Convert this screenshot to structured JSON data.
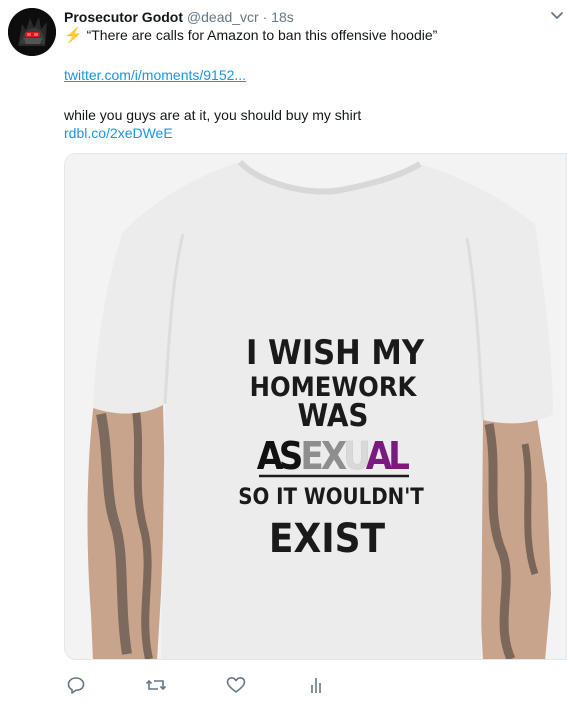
{
  "tweet": {
    "author_name": "Prosecutor Godot",
    "handle": "@dead_vcr",
    "separator": "·",
    "time": "18s",
    "quote_text": "“There are calls for Amazon to ban this offensive hoodie”",
    "link": "twitter.com/i/moments/9152...",
    "body": "while you guys are at it, you should buy my shirt",
    "short_link": "rdbl.co/2xeDWeE"
  },
  "media": {
    "shirt_text": {
      "line1": "I WISH MY",
      "line2": "HOMEWORK",
      "line3": "WAS",
      "line4_letters": [
        "A",
        "S",
        "E",
        "X",
        "U",
        "A",
        "L"
      ],
      "line5": "SO IT WOULDN'T",
      "line6": "EXIST"
    },
    "colors": {
      "ace_black": "#111111",
      "ace_grey": "#8e8e8e",
      "ace_white": "#e6e6e6",
      "ace_purple": "#7b1a7e"
    }
  },
  "icons": [
    "reply-icon",
    "retweet-icon",
    "like-icon",
    "analytics-icon",
    "chevron-down-icon"
  ]
}
